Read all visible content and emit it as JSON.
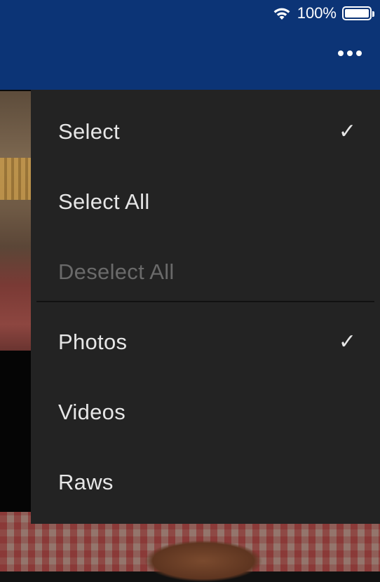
{
  "status_bar": {
    "battery_text": "100%",
    "wifi_icon": "wifi-icon",
    "battery_icon": "battery-icon",
    "battery_level": 1.0
  },
  "toolbar": {
    "more_icon": "more-horizontal-icon"
  },
  "menu": {
    "items": [
      {
        "label": "Select",
        "checked": true,
        "enabled": true
      },
      {
        "label": "Select All",
        "checked": false,
        "enabled": true
      },
      {
        "label": "Deselect All",
        "checked": false,
        "enabled": false
      },
      {
        "label": "Photos",
        "checked": true,
        "enabled": true
      },
      {
        "label": "Videos",
        "checked": false,
        "enabled": true
      },
      {
        "label": "Raws",
        "checked": false,
        "enabled": true
      }
    ],
    "check_glyph": "✓"
  },
  "colors": {
    "header_bg": "#0c3476",
    "menu_bg": "#232323",
    "menu_text": "#e6e6e6",
    "disabled_text": "#6a6a6a"
  }
}
